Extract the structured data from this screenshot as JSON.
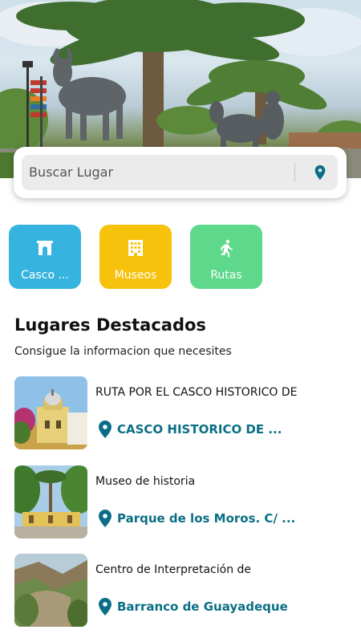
{
  "search": {
    "placeholder": "Buscar Lugar"
  },
  "categories": [
    {
      "label": "Casco ...",
      "color": "#36b4df",
      "icon": "arch-icon"
    },
    {
      "label": "Museos",
      "color": "#f7c20c",
      "icon": "building-icon"
    },
    {
      "label": "Rutas",
      "color": "#5ed88a",
      "icon": "walking-icon"
    }
  ],
  "section": {
    "title": "Lugares Destacados",
    "subtitle": "Consigue la informacion que necesites"
  },
  "places": [
    {
      "title": "RUTA POR EL CASCO HISTORICO DE",
      "location": "CASCO HISTORICO DE ..."
    },
    {
      "title": "Museo de historia",
      "location": "Parque de los Moros. C/ ..."
    },
    {
      "title": "Centro de Interpretación de",
      "location": "Barranco de Guayadeque"
    }
  ],
  "colors": {
    "accent": "#0a6f86",
    "search_bg": "#ebebeb"
  }
}
